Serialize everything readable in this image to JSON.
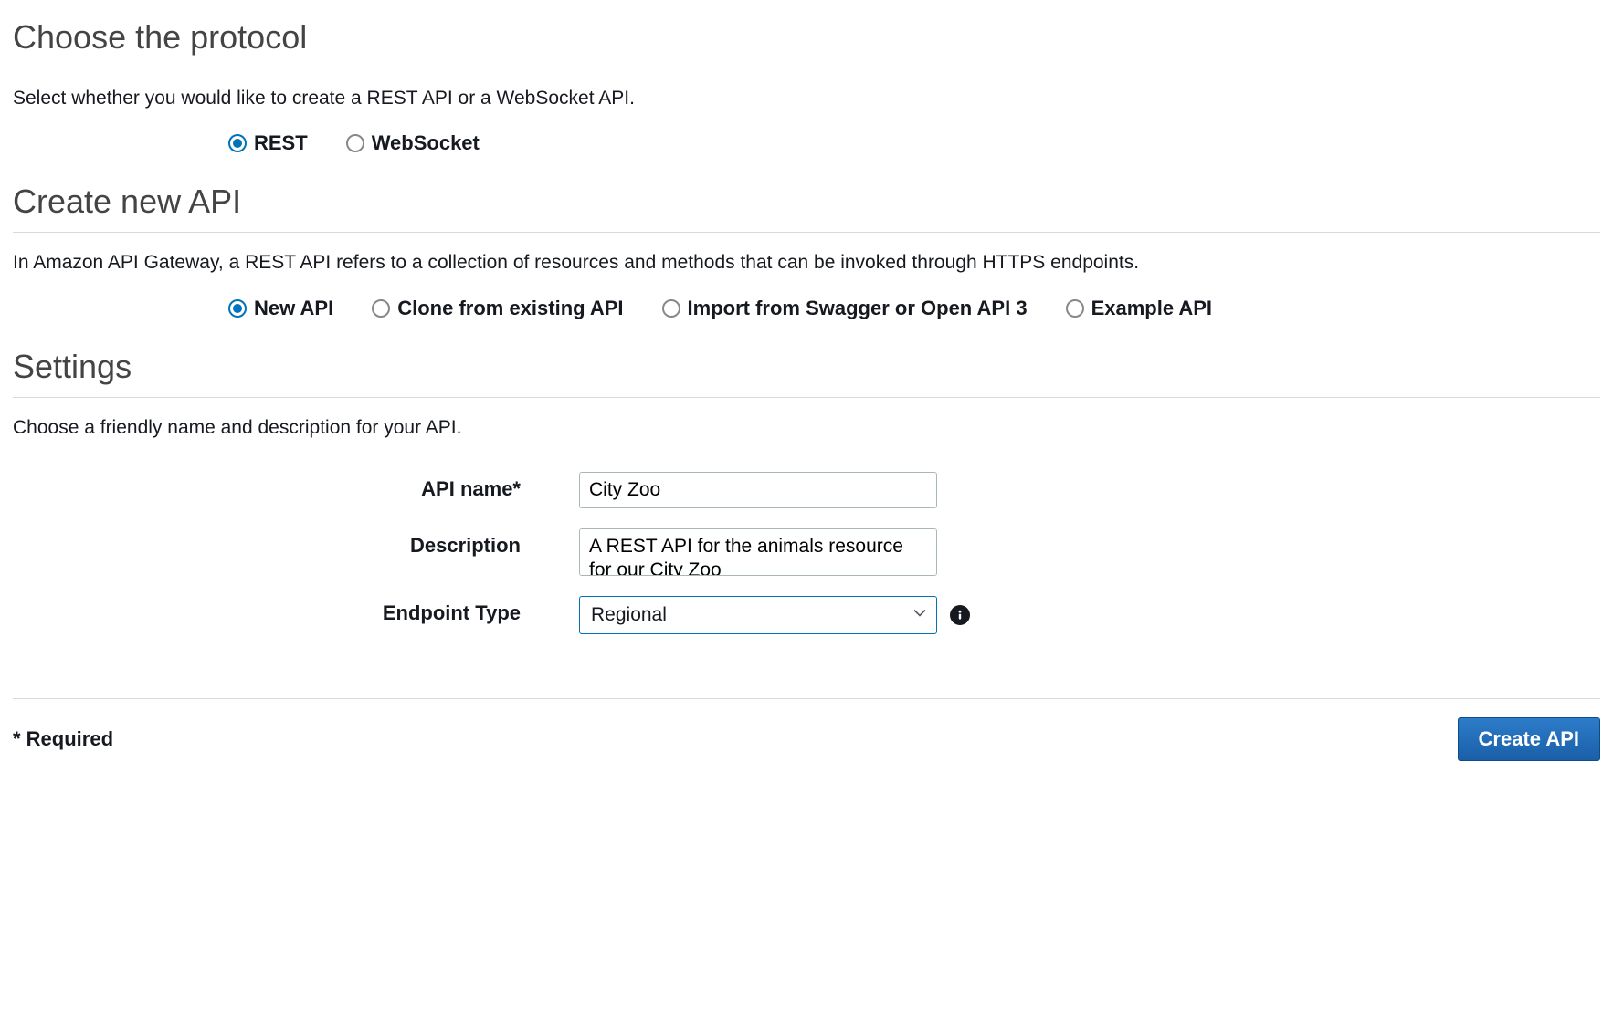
{
  "protocol": {
    "title": "Choose the protocol",
    "desc": "Select whether you would like to create a REST API or a WebSocket API.",
    "options": {
      "rest": "REST",
      "websocket": "WebSocket"
    },
    "selected": "rest"
  },
  "createApi": {
    "title": "Create new API",
    "desc": "In Amazon API Gateway, a REST API refers to a collection of resources and methods that can be invoked through HTTPS endpoints.",
    "options": {
      "new": "New API",
      "clone": "Clone from existing API",
      "import": "Import from Swagger or Open API 3",
      "example": "Example API"
    },
    "selected": "new"
  },
  "settings": {
    "title": "Settings",
    "desc": "Choose a friendly name and description for your API.",
    "labels": {
      "apiName": "API name*",
      "description": "Description",
      "endpointType": "Endpoint Type"
    },
    "values": {
      "apiName": "City Zoo",
      "description": "A REST API for the animals resource for our City Zoo",
      "endpointType": "Regional"
    }
  },
  "footer": {
    "required": "* Required",
    "createButton": "Create API"
  }
}
